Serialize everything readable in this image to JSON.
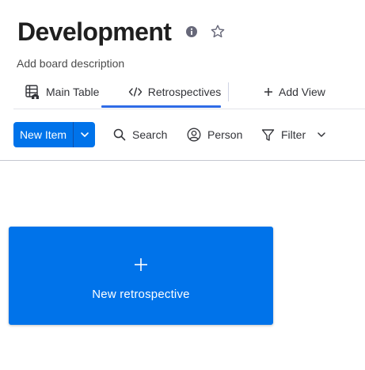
{
  "board": {
    "title": "Development",
    "description": "Add board description"
  },
  "tabs": {
    "main_table": "Main Table",
    "retrospectives": "Retrospectives",
    "add_view": "Add View",
    "active": "Retrospectives"
  },
  "toolbar": {
    "new_item": "New Item",
    "search": "Search",
    "person": "Person",
    "filter": "Filter"
  },
  "retrospective_card": {
    "label": "New retrospective"
  },
  "colors": {
    "primary": "#0073ea",
    "tab_underline": "#2f6be6",
    "text": "#323338"
  },
  "icons": [
    "info-icon",
    "star-icon",
    "table-icon",
    "code-icon",
    "plus-icon",
    "chevron-down-icon",
    "search-icon",
    "person-icon",
    "filter-icon"
  ]
}
